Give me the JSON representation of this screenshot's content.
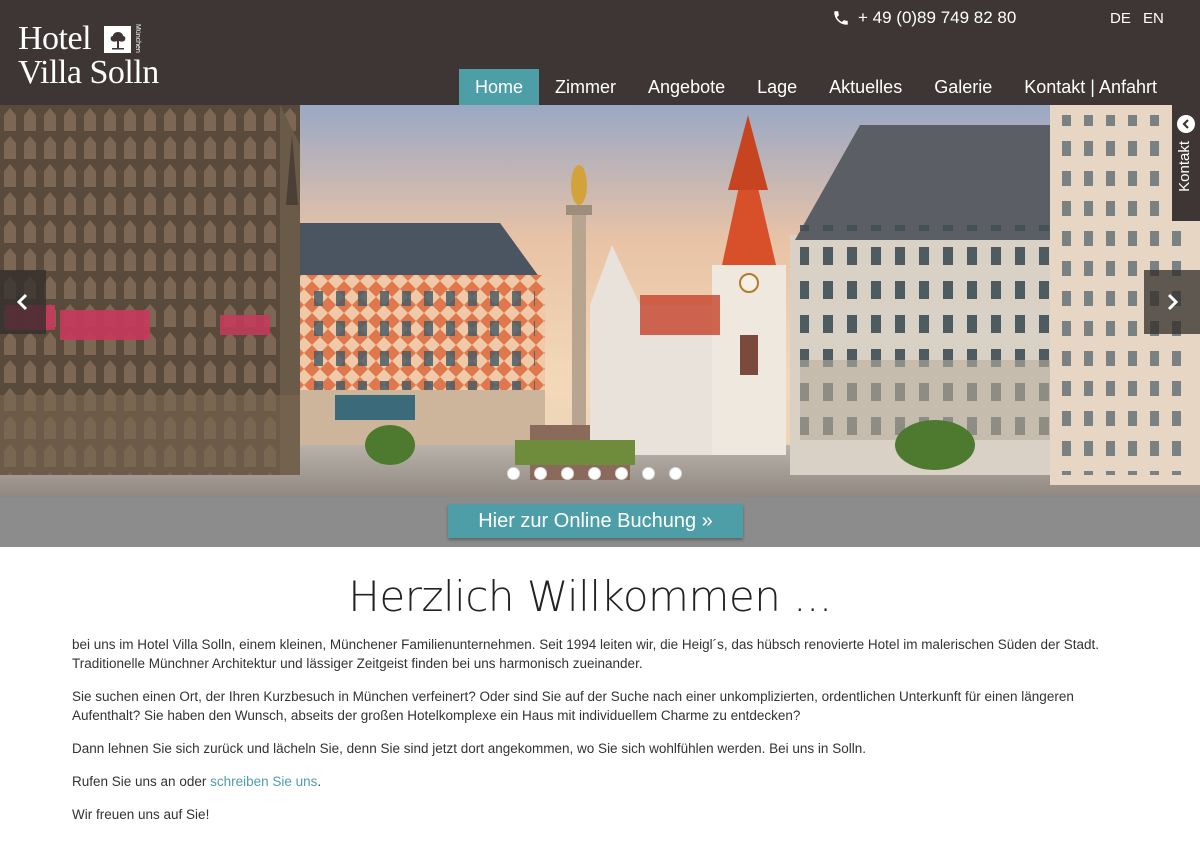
{
  "header": {
    "logo_line1": "Hotel",
    "logo_line2": "Villa Solln",
    "logo_small": "München",
    "phone": "+ 49 (0)89 749 82 80",
    "lang_de": "DE",
    "lang_en": "EN"
  },
  "nav": {
    "items": [
      {
        "label": "Home",
        "active": true
      },
      {
        "label": "Zimmer"
      },
      {
        "label": "Angebote"
      },
      {
        "label": "Lage"
      },
      {
        "label": "Aktuelles"
      },
      {
        "label": "Galerie"
      },
      {
        "label": "Kontakt | Anfahrt"
      }
    ]
  },
  "side_tab": {
    "label": "Kontakt"
  },
  "booking": {
    "label": "Hier zur Online Buchung »"
  },
  "content": {
    "title": "Herzlich Willkommen ...",
    "p1": "bei uns im Hotel Villa Solln, einem kleinen, Münchener Familienunternehmen. Seit 1994 leiten wir, die Heigl´s, das hübsch renovierte Hotel im malerischen Süden der Stadt. Traditionelle Münchner Architektur und lässiger Zeitgeist finden bei uns harmonisch zueinander.",
    "p2": "Sie suchen einen Ort, der Ihren Kurzbesuch in München verfeinert? Oder sind Sie auf der Suche nach einer unkomplizierten, ordentlichen Unterkunft für einen längeren Aufenthalt? Sie haben den Wunsch, abseits der großen Hotelkomplexe ein Haus mit individuellem Charme zu entdecken?",
    "p3": "Dann lehnen Sie sich zurück und lächeln Sie, denn Sie sind jetzt dort angekommen, wo Sie sich wohlfühlen werden. Bei uns in Solln.",
    "p4_prefix": "Rufen Sie uns an oder ",
    "p4_link": "schreiben Sie uns",
    "p4_suffix": ".",
    "p5": "Wir freuen uns auf Sie!"
  },
  "colors": {
    "header_bg": "#3d3634",
    "accent": "#4e9ea8",
    "booking_bar": "#8d8c8c"
  },
  "icons": {
    "phone": "phone-icon",
    "prev": "chevron-left-icon",
    "next": "chevron-right-icon",
    "side": "chevron-left-circle-icon"
  }
}
